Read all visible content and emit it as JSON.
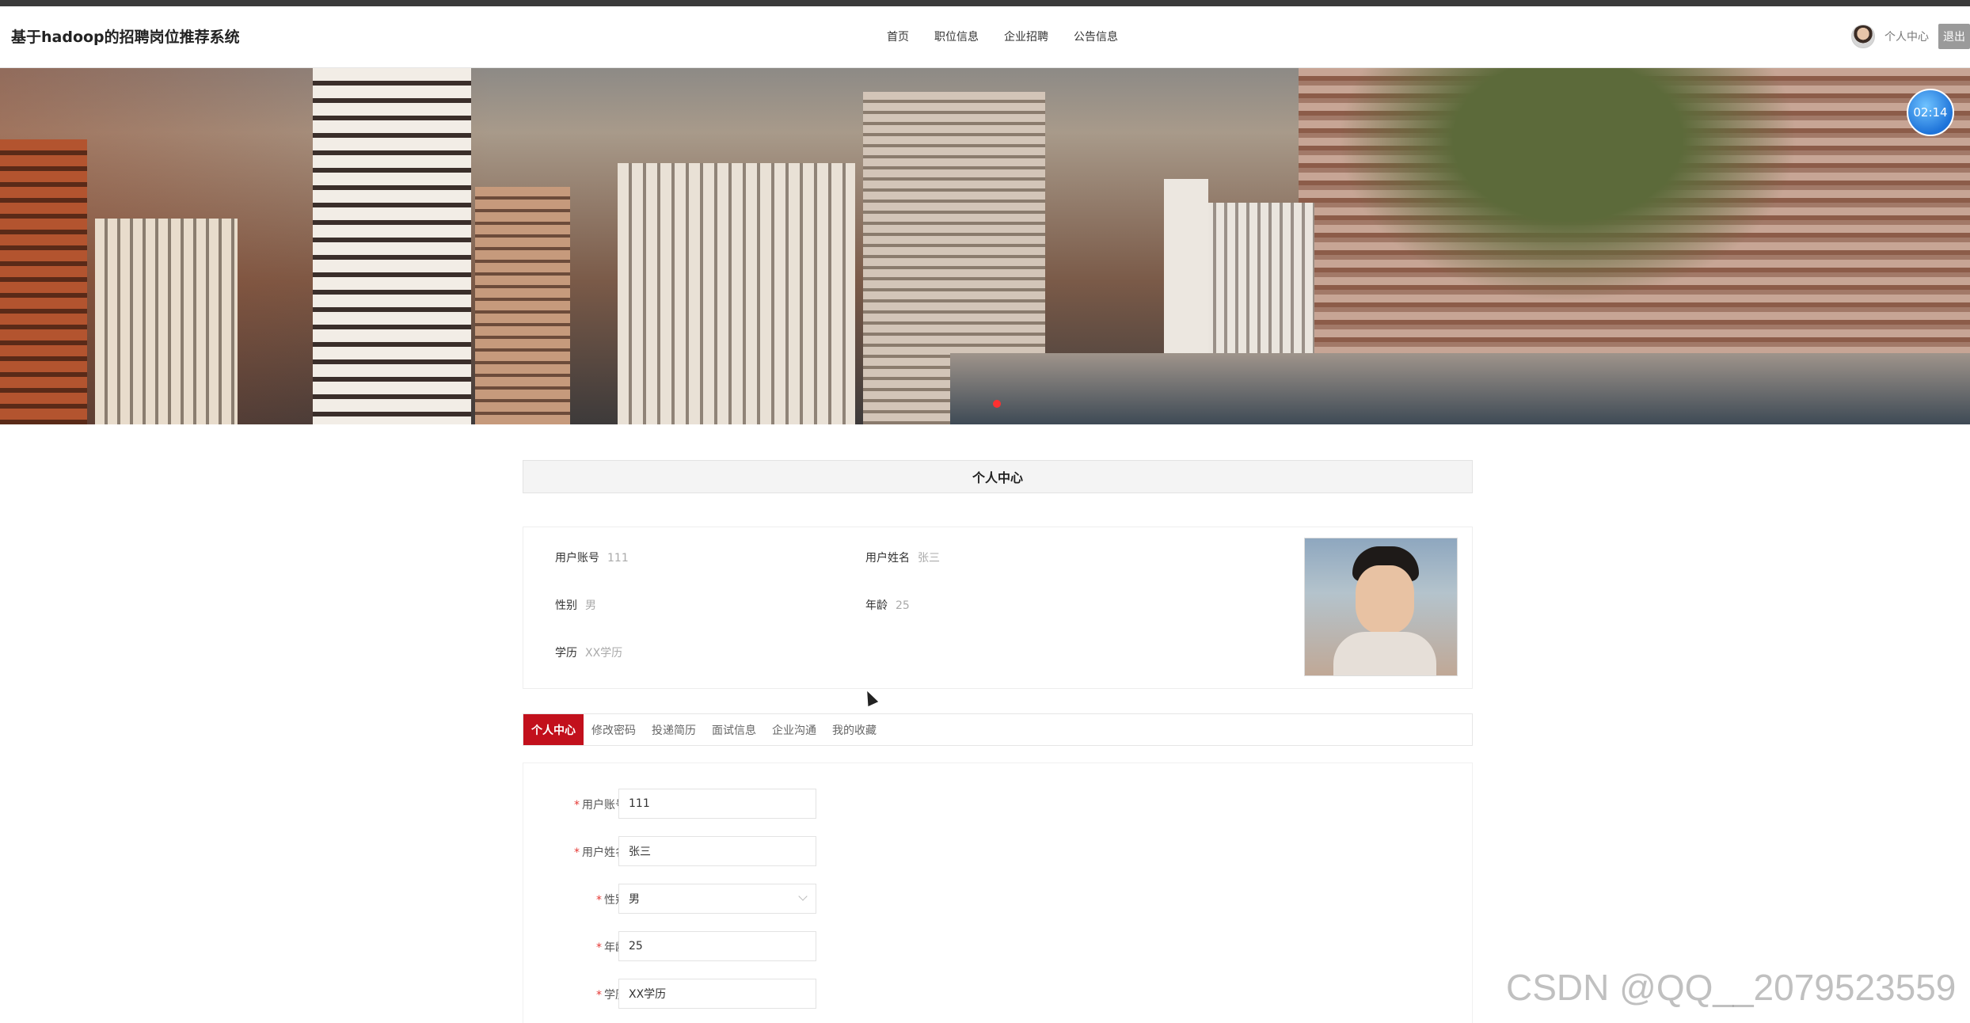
{
  "header": {
    "site_title": "基于hadoop的招聘岗位推荐系统",
    "nav": [
      "首页",
      "职位信息",
      "企业招聘",
      "公告信息"
    ],
    "user_center": "个人中心",
    "logout": "退出"
  },
  "banner": {
    "timer": "02:14"
  },
  "panel": {
    "title": "个人中心"
  },
  "profile": {
    "account_label": "用户账号",
    "account_value": "111",
    "name_label": "用户姓名",
    "name_value": "张三",
    "gender_label": "性别",
    "gender_value": "男",
    "age_label": "年龄",
    "age_value": "25",
    "education_label": "学历",
    "education_value": "XX学历"
  },
  "tabs": [
    "个人中心",
    "修改密码",
    "投递简历",
    "面试信息",
    "企业沟通",
    "我的收藏"
  ],
  "form": {
    "account_label": "用户账号",
    "account_value": "111",
    "name_label": "用户姓名",
    "name_value": "张三",
    "gender_label": "性别",
    "gender_value": "男",
    "age_label": "年龄",
    "age_value": "25",
    "education_label": "学历",
    "education_value": "XX学历"
  },
  "watermark": "CSDN @QQ__2079523559",
  "colors": {
    "accent": "#c2101c",
    "required": "#e53935"
  }
}
